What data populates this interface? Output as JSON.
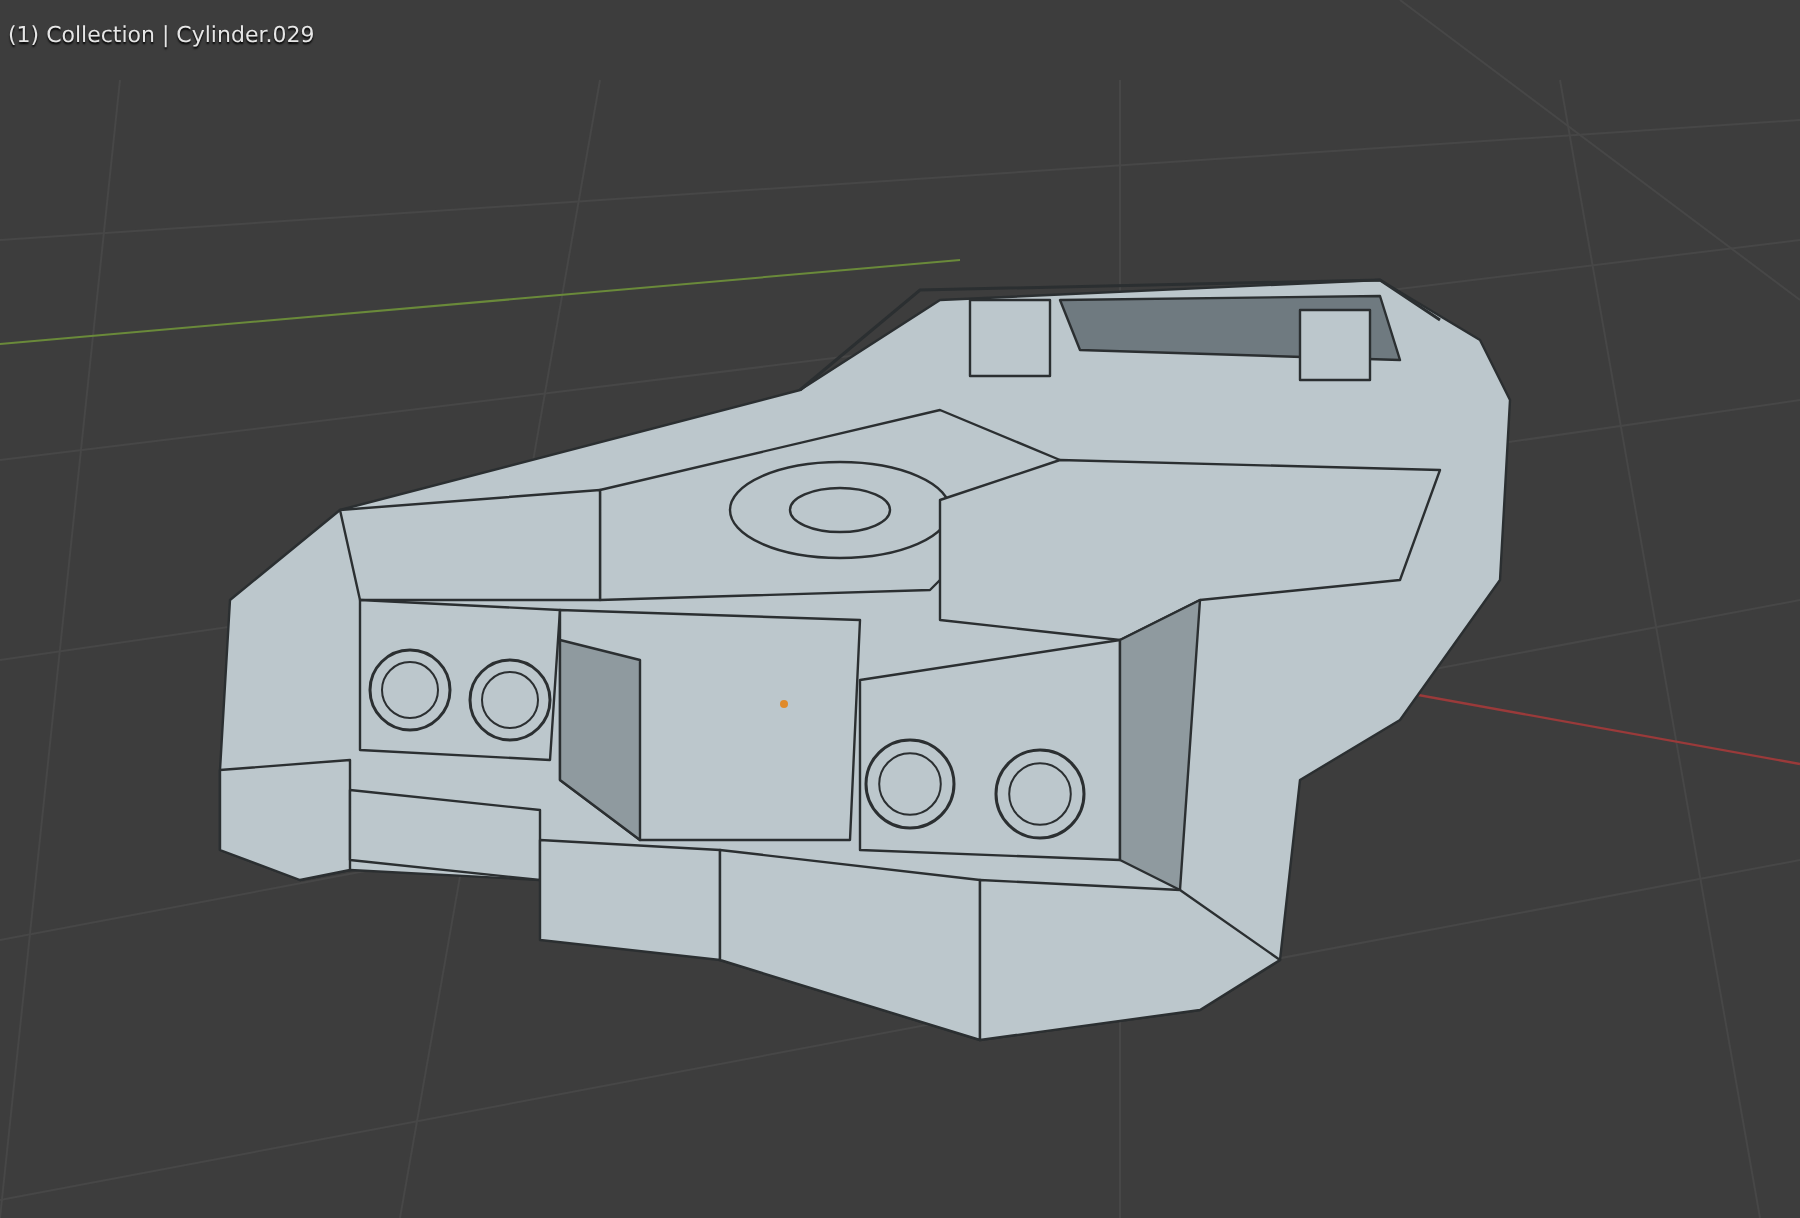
{
  "viewport": {
    "info_line": "(1) Collection | Cylinder.029"
  }
}
